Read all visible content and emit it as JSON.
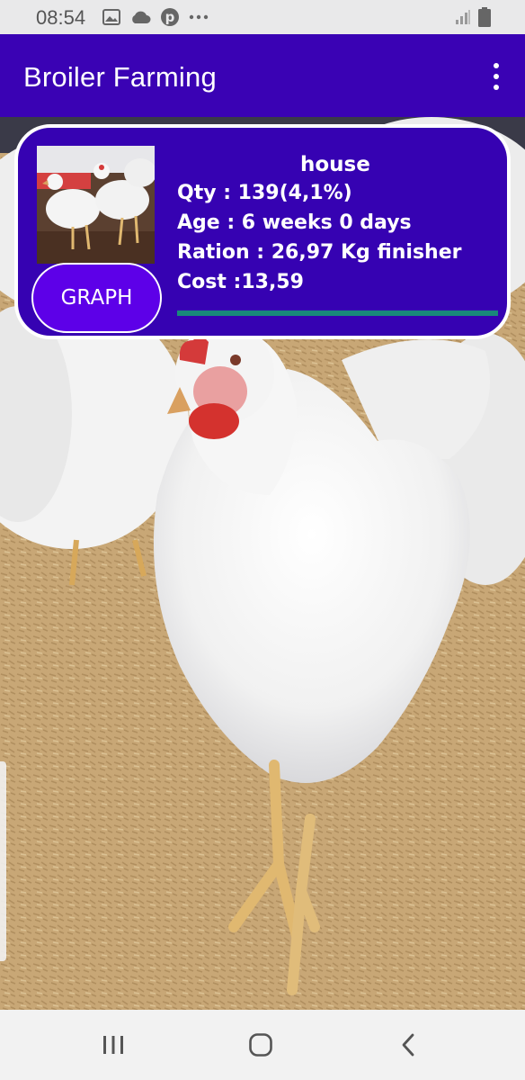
{
  "status_bar": {
    "time": "08:54",
    "left_icons": [
      "image-icon",
      "cloud-icon",
      "pinterest-icon",
      "more-dots-icon"
    ],
    "right_icons": [
      "signal-icon",
      "battery-icon"
    ]
  },
  "app_bar": {
    "title": "Broiler Farming",
    "menu_icon": "overflow-menu-icon"
  },
  "card": {
    "title": "house",
    "qty": "Qty : 139(4,1%)",
    "age": "Age : 6 weeks 0 days",
    "ration": "Ration : 26,97 Kg finisher",
    "cost": "Cost :13,59",
    "graph_button": "GRAPH",
    "progress": 1.0
  },
  "nav_bar": {
    "items": [
      "recent-apps-icon",
      "home-icon",
      "back-icon"
    ]
  },
  "colors": {
    "app_bar": "#3a02b4",
    "card": "#3602b2",
    "graph_button": "#5d00e8",
    "progress": "#19897a"
  }
}
